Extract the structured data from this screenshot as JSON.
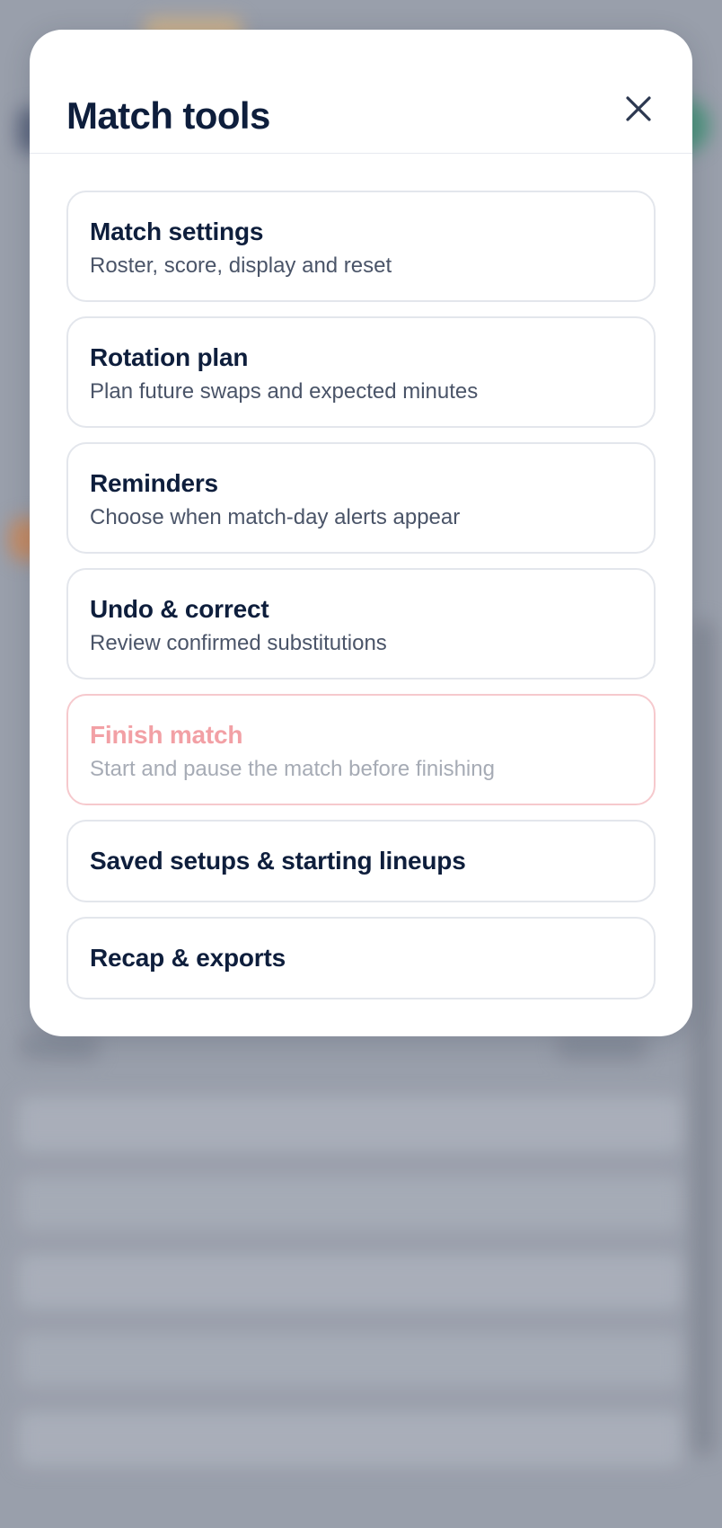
{
  "modal": {
    "title": "Match tools",
    "close_icon": "close-icon",
    "options": [
      {
        "title": "Match settings",
        "subtitle": "Roster, score, display and reset",
        "enabled": true
      },
      {
        "title": "Rotation plan",
        "subtitle": "Plan future swaps and expected minutes",
        "enabled": true
      },
      {
        "title": "Reminders",
        "subtitle": "Choose when match-day alerts appear",
        "enabled": true
      },
      {
        "title": "Undo & correct",
        "subtitle": "Review confirmed substitutions",
        "enabled": true
      },
      {
        "title": "Finish match",
        "subtitle": "Start and pause the match before finishing",
        "enabled": false
      },
      {
        "title": "Saved setups & starting lineups",
        "enabled": true
      },
      {
        "title": "Recap & exports",
        "enabled": true
      }
    ]
  },
  "colors": {
    "title_text": "#0e1e3c",
    "subtitle_text": "#4a5468",
    "disabled_title": "#f2a0a5",
    "disabled_border": "#f6c9cd",
    "backdrop": "#a0a5b1"
  }
}
